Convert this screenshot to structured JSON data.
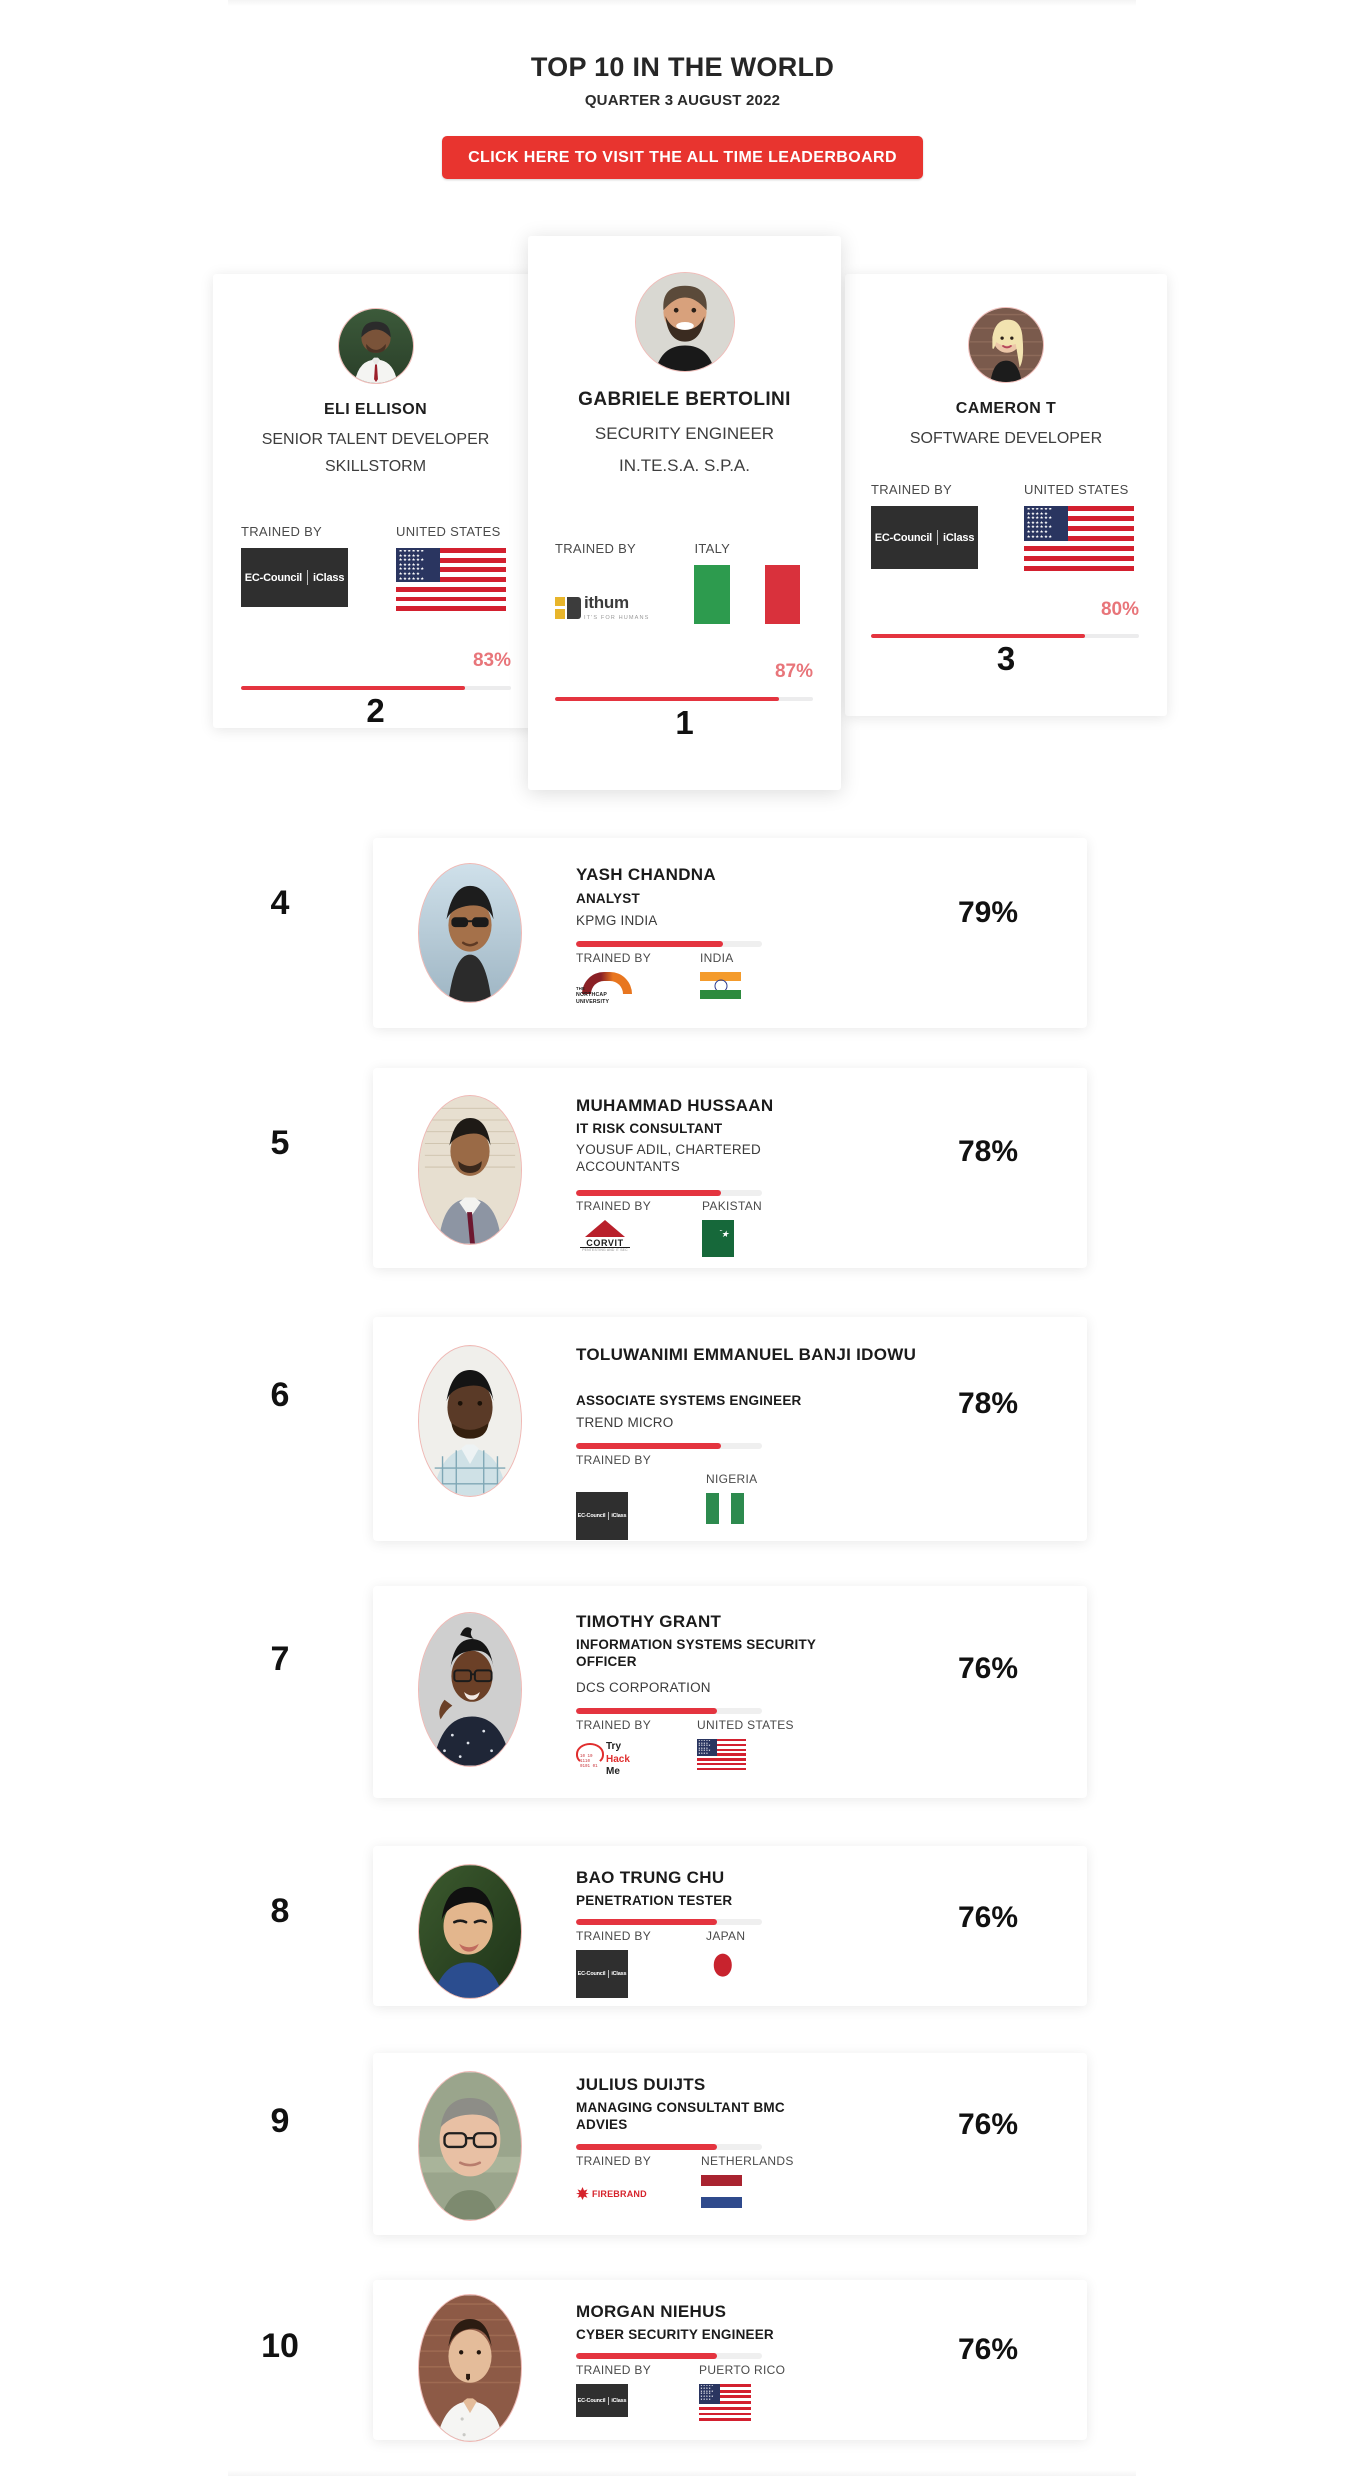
{
  "header": {
    "title": "TOP 10 IN THE WORLD",
    "subtitle": "QUARTER 3 AUGUST 2022",
    "cta_label": "CLICK HERE TO VISIT THE ALL TIME LEADERBOARD"
  },
  "labels": {
    "trained_by": "TRAINED BY"
  },
  "colors": {
    "accent_red": "#e4343f",
    "cta_red": "#e8342f",
    "pct_pink": "#e8757a",
    "bar_track": "#efefef"
  },
  "podium": [
    {
      "rank": "2",
      "name": "ELI ELLISON",
      "role": "SENIOR TALENT DEVELOPER",
      "org": "SKILLSTORM",
      "trained_by_label": "TRAINED BY",
      "trainer": "EC-Council | iClass",
      "country": "UNITED STATES",
      "flag": "us",
      "percent": "83%",
      "percent_value": 83
    },
    {
      "rank": "1",
      "name": "GABRIELE BERTOLINI",
      "role": "SECURITY ENGINEER",
      "org": "IN.TE.S.A. S.P.A.",
      "trained_by_label": "TRAINED BY",
      "trainer": "ithum — IT'S FOR HUMANS",
      "country": "ITALY",
      "flag": "it",
      "percent": "87%",
      "percent_value": 87
    },
    {
      "rank": "3",
      "name": "CAMERON T",
      "role": "SOFTWARE DEVELOPER",
      "org": "",
      "trained_by_label": "TRAINED BY",
      "trainer": "EC-Council | iClass",
      "country": "UNITED STATES",
      "flag": "us",
      "percent": "80%",
      "percent_value": 80
    }
  ],
  "rows": [
    {
      "rank": "4",
      "name": "YASH CHANDNA",
      "role": "ANALYST",
      "org": "KPMG INDIA",
      "trained_by_label": "TRAINED BY",
      "trainer": "THE NORTHCAP UNIVERSITY",
      "country": "INDIA",
      "flag": "in",
      "percent": "79%",
      "percent_value": 79
    },
    {
      "rank": "5",
      "name": "MUHAMMAD HUSSAAN",
      "role": "IT RISK CONSULTANT",
      "org": "YOUSUF ADIL, CHARTERED ACCOUNTANTS",
      "trained_by_label": "TRAINED BY",
      "trainer": "CORVIT",
      "country": "PAKISTAN",
      "flag": "pk",
      "percent": "78%",
      "percent_value": 78
    },
    {
      "rank": "6",
      "name": "TOLUWANIMI EMMANUEL BANJI IDOWU",
      "role": "ASSOCIATE SYSTEMS ENGINEER",
      "org": "TREND MICRO",
      "trained_by_label": "TRAINED BY",
      "trainer": "EC-Council | iClass",
      "country": "NIGERIA",
      "flag": "ng",
      "percent": "78%",
      "percent_value": 78
    },
    {
      "rank": "7",
      "name": "TIMOTHY GRANT",
      "role": "INFORMATION SYSTEMS SECURITY OFFICER",
      "org": "DCS CORPORATION",
      "trained_by_label": "TRAINED BY",
      "trainer": "TryHackMe",
      "country": "UNITED STATES",
      "flag": "us",
      "percent": "76%",
      "percent_value": 76
    },
    {
      "rank": "8",
      "name": "BAO TRUNG CHU",
      "role": "PENETRATION TESTER",
      "org": "",
      "trained_by_label": "TRAINED BY",
      "trainer": "EC-Council | iClass",
      "country": "JAPAN",
      "flag": "jp",
      "percent": "76%",
      "percent_value": 76
    },
    {
      "rank": "9",
      "name": "JULIUS DUIJTS",
      "role": "MANAGING CONSULTANT BMC ADVIES",
      "org": "",
      "trained_by_label": "TRAINED BY",
      "trainer": "FIREBRAND",
      "country": "NETHERLANDS",
      "flag": "nl",
      "percent": "76%",
      "percent_value": 76
    },
    {
      "rank": "10",
      "name": "MORGAN NIEHUS",
      "role": "CYBER SECURITY ENGINEER",
      "org": "",
      "trained_by_label": "TRAINED BY",
      "trainer": "EC-Council | iClass",
      "country": "PUERTO RICO",
      "flag": "us",
      "percent": "76%",
      "percent_value": 76
    }
  ],
  "trainer_logos": {
    "eccouncil_left": "EC-Council",
    "eccouncil_right": "iClass",
    "ithum_word": "ithum",
    "ithum_tagline": "IT'S FOR HUMANS",
    "northcap_l1": "THE",
    "northcap_l2": "NORTHCAP",
    "northcap_l3": "UNIVERSITY",
    "corvit_word": "CORVIT",
    "corvit_sub": "PENTESTING AND IT SEC",
    "thm_l1": "Try",
    "thm_l2": "Hack",
    "thm_l3": "Me",
    "thm_bits": "10 10\n1110\n0101 01",
    "firebrand_word": "FIREBRAND"
  }
}
